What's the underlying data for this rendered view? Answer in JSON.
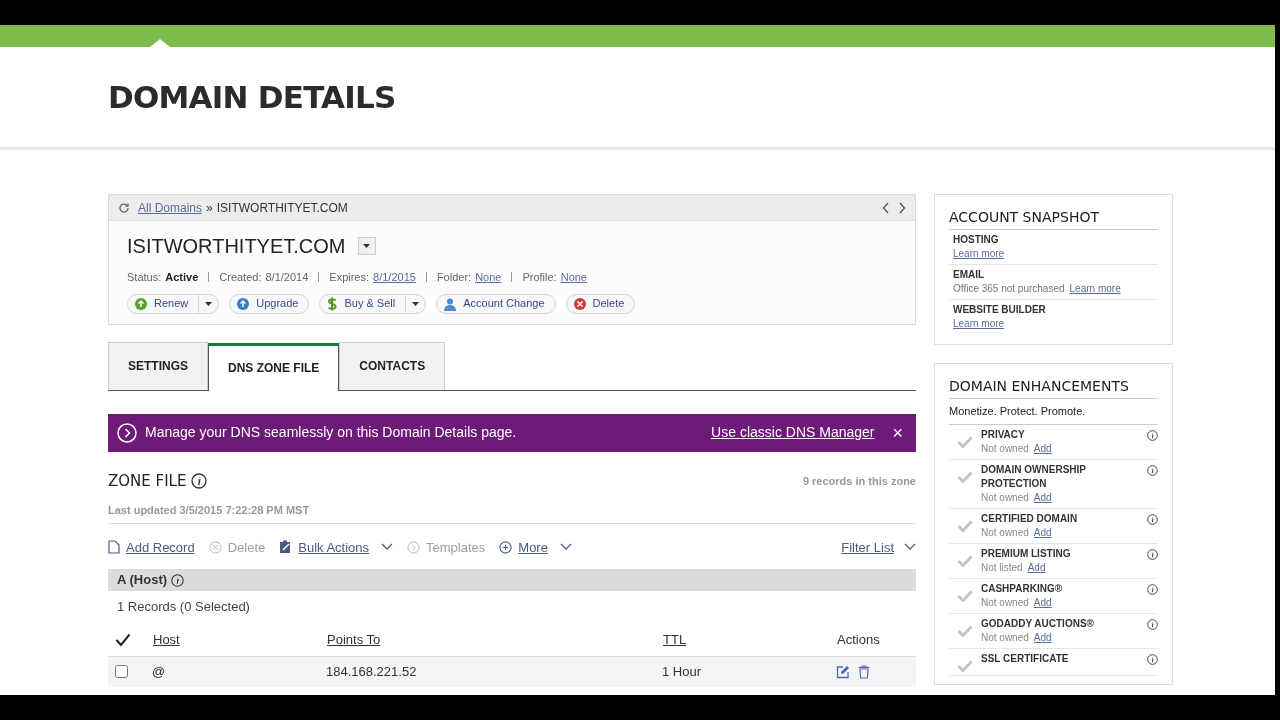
{
  "page_title": "DOMAIN DETAILS",
  "breadcrumb": {
    "link": "All Domains",
    "separator": "»",
    "current": "ISITWORTHITYET.COM"
  },
  "domain": {
    "name": "ISITWORTHITYET.COM",
    "meta": [
      {
        "label": "Status:",
        "value": "Active",
        "kind": "bold"
      },
      {
        "label": "Created:",
        "value": "8/1/2014",
        "kind": "plain"
      },
      {
        "label": "Expires:",
        "value": "8/1/2015",
        "kind": "link"
      },
      {
        "label": "Folder:",
        "value": "None",
        "kind": "link"
      },
      {
        "label": "Profile:",
        "value": "None",
        "kind": "link"
      }
    ],
    "actions": [
      {
        "label": "Renew",
        "kind": "renew",
        "dropdown": true
      },
      {
        "label": "Upgrade",
        "kind": "upgrade",
        "dropdown": false
      },
      {
        "label": "Buy & Sell",
        "kind": "trade",
        "dropdown": true
      },
      {
        "label": "Account Change",
        "kind": "account",
        "dropdown": false
      },
      {
        "label": "Delete",
        "kind": "delete",
        "dropdown": false
      }
    ]
  },
  "tabs": [
    {
      "label": "SETTINGS",
      "selected": false
    },
    {
      "label": "DNS ZONE FILE",
      "selected": true
    },
    {
      "label": "CONTACTS",
      "selected": false
    }
  ],
  "banner": {
    "message": "Manage your DNS seamlessly on this Domain Details page.",
    "link": "Use classic DNS Manager",
    "close": "×"
  },
  "zone": {
    "title": "ZONE FILE",
    "count": "9 records in this zone",
    "updated": "Last updated 3/5/2015 7:22:28 PM MST",
    "toolbar": [
      {
        "label": "Add Record",
        "kind": "add",
        "disabled": false,
        "dropdown": false
      },
      {
        "label": "Delete",
        "kind": "delete",
        "disabled": true,
        "dropdown": false
      },
      {
        "label": "Bulk Actions",
        "kind": "bulk",
        "disabled": false,
        "dropdown": true
      },
      {
        "label": "Templates",
        "kind": "templates",
        "disabled": true,
        "dropdown": false
      },
      {
        "label": "More",
        "kind": "more",
        "disabled": false,
        "dropdown": true
      }
    ],
    "filter": "Filter List",
    "section": {
      "title": "A (Host)",
      "records": "1 Records (0 Selected)",
      "columns": [
        "Host",
        "Points To",
        "TTL",
        "Actions"
      ],
      "rows": [
        {
          "checked": false,
          "host": "@",
          "points_to": "184.168.221.52",
          "ttl": "1 Hour"
        }
      ]
    }
  },
  "snapshot": {
    "title": "ACCOUNT SNAPSHOT",
    "items": [
      {
        "name": "HOSTING",
        "link": "Learn more"
      },
      {
        "name": "EMAIL",
        "note": "Office 365 not purchased",
        "link": "Learn more"
      },
      {
        "name": "WEBSITE BUILDER",
        "link": "Learn more"
      }
    ]
  },
  "enhancements": {
    "title": "DOMAIN ENHANCEMENTS",
    "tagline": "Monetize. Protect. Promote.",
    "items": [
      {
        "name": "PRIVACY",
        "status": "Not owned",
        "link": "Add"
      },
      {
        "name": "DOMAIN OWNERSHIP PROTECTION",
        "status": "Not owned",
        "link": "Add"
      },
      {
        "name": "CERTIFIED DOMAIN",
        "status": "Not owned",
        "link": "Add"
      },
      {
        "name": "PREMIUM LISTING",
        "status": "Not listed",
        "link": "Add"
      },
      {
        "name": "CASHPARKING®",
        "status": "Not owned",
        "link": "Add"
      },
      {
        "name": "GODADDY AUCTIONS®",
        "status": "Not owned",
        "link": "Add"
      },
      {
        "name": "SSL CERTIFICATE"
      }
    ]
  }
}
